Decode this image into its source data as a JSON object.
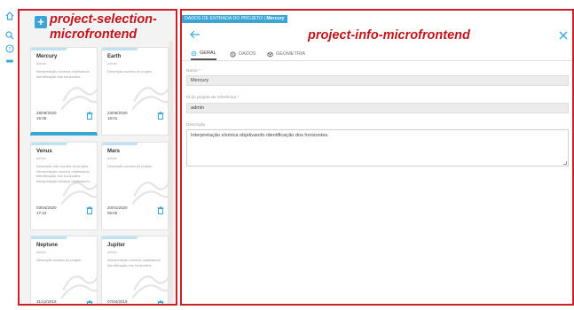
{
  "annotations": {
    "left_label_line1": "project-selection-",
    "left_label_line2": "microfrontend",
    "right_label": "project-info-microfrontend"
  },
  "sidebar": {
    "icons": [
      "home-icon",
      "search-icon",
      "help-icon",
      "toggle-icon"
    ]
  },
  "project_list": {
    "add_label": "+",
    "projects": [
      {
        "name": "Mercury",
        "owner": "admin",
        "description": "Interpretação sísmica objetivando identificação dos horizontes.",
        "date": "28/08/2020",
        "time": "15:05",
        "selected": true
      },
      {
        "name": "Earth",
        "owner": "admin",
        "description": "Descrição sucinta do projeto",
        "date": "23/08/2020",
        "time": "16:01",
        "selected": false
      },
      {
        "name": "Venus",
        "owner": "admin",
        "description": "Descrição não sucinta do projeto. Interpretação sísmica objetivando identificação dos horizontes. Interpretação sísmica objetivando...",
        "date": "03/04/2020",
        "time": "17:34",
        "selected": false
      },
      {
        "name": "Mars",
        "owner": "admin",
        "description": "Descrição sucinta do projeto",
        "date": "20/01/2020",
        "time": "06:00",
        "selected": false
      },
      {
        "name": "Neptune",
        "owner": "admin",
        "description": "Descrição sucinta do projeto",
        "date": "31/12/2019",
        "time": "",
        "selected": false
      },
      {
        "name": "Jupiter",
        "owner": "admin",
        "description": "Interpretação sísmica objetivando identificação dos horizontes.",
        "date": "07/04/2019",
        "time": "",
        "selected": false
      }
    ]
  },
  "project_info": {
    "breadcrumb_prefix": "DADOS DE ENTRADA DO PROJETO | ",
    "breadcrumb_project": "Mercury",
    "tabs": [
      {
        "label": "GERAL",
        "icon": "gear-icon",
        "active": true
      },
      {
        "label": "DADOS",
        "icon": "database-icon",
        "active": false
      },
      {
        "label": "GEOMETRIA",
        "icon": "cube-icon",
        "active": false
      }
    ],
    "fields": {
      "name_label": "Nome *",
      "name_value": "Mercury",
      "reference_label": "Id do projeto de referência *",
      "reference_value": "admin",
      "description_label": "Descrição",
      "description_value": "Interpretação sísmica objetivando identificação dos horizontes."
    }
  },
  "colors": {
    "accent": "#3ba6d6",
    "frame": "#cc2027",
    "label": "#c0141c"
  }
}
